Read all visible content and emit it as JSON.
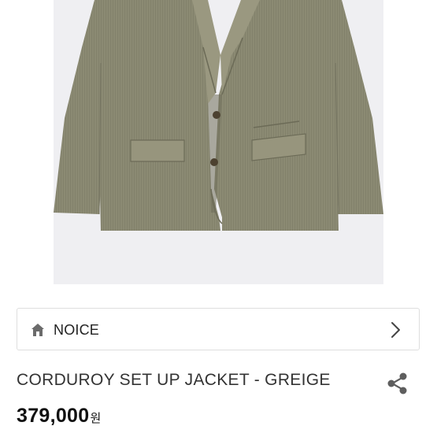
{
  "product_image": {
    "subject": "corduroy-set-up-jacket-greige",
    "background_color": "#efeff2",
    "jacket_color": "#8b8a73"
  },
  "brand_row": {
    "icon": "home-icon",
    "brand_name": "NOICE",
    "arrow_icon": "chevron-right-icon"
  },
  "product": {
    "title": "CORDUROY SET UP JACKET - GREIGE",
    "price_amount": "379,000",
    "price_unit": "원"
  },
  "share": {
    "icon": "share-icon"
  }
}
